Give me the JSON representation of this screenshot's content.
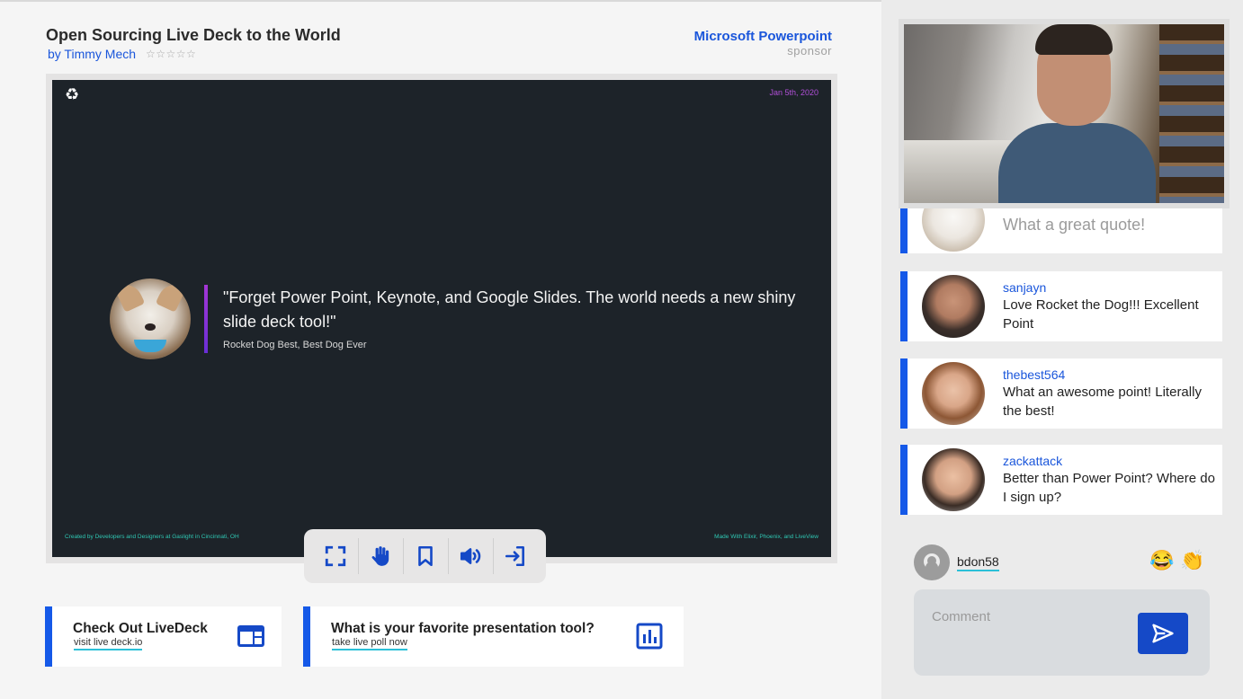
{
  "header": {
    "title": "Open Sourcing Live Deck to the World",
    "byline": "by Timmy Mech",
    "stars": "☆☆☆☆☆",
    "sponsor_name": "Microsoft Powerpoint",
    "sponsor_label": "sponsor"
  },
  "slide": {
    "date": "Jan 5th, 2020",
    "quote": "\"Forget Power Point, Keynote, and Google Slides. The world needs a new shiny slide deck tool!\"",
    "author": "Rocket Dog Best, Best Dog Ever",
    "footer_left": "Created by Developers and Designers at Gaslight in Cincinnati, OH",
    "footer_right": "Made With Elixir, Phoenix, and LiveView"
  },
  "controls": [
    {
      "name": "fullscreen-icon"
    },
    {
      "name": "raise-hand-icon"
    },
    {
      "name": "bookmark-icon"
    },
    {
      "name": "volume-icon"
    },
    {
      "name": "exit-icon"
    }
  ],
  "ctas": [
    {
      "title": "Check Out LiveDeck",
      "link": "visit live deck.io",
      "icon": "website-icon"
    },
    {
      "title": "What is your favorite presentation tool?",
      "link": "take live poll now",
      "icon": "poll-chart-icon"
    }
  ],
  "comments": [
    {
      "user": "",
      "text": "What a great quote!"
    },
    {
      "user": "sanjayn",
      "text": "Love Rocket the Dog!!! Excellent Point"
    },
    {
      "user": "thebest564",
      "text": "What an awesome point! Literally the best!"
    },
    {
      "user": "zackattack",
      "text": "Better than Power Point? Where do I sign up?"
    }
  ],
  "composer": {
    "username": "bdon58",
    "emoji1": "😂",
    "emoji2": "👏",
    "placeholder": "Comment",
    "value": ""
  },
  "colors": {
    "accent": "#1559e8",
    "slide_bg": "#1d2329",
    "footer_teal": "#2fc7b3",
    "date_purple": "#b14fd8"
  }
}
